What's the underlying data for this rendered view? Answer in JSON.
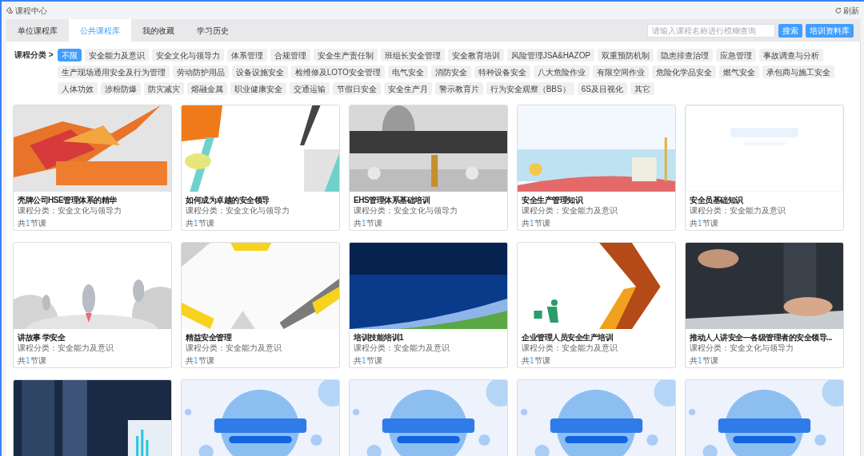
{
  "window": {
    "title": "课程中心",
    "refresh": "刷新"
  },
  "tabs": [
    {
      "label": "单位课程库",
      "selected": false
    },
    {
      "label": "公共课程库",
      "selected": true
    },
    {
      "label": "我的收藏",
      "selected": false
    },
    {
      "label": "学习历史",
      "selected": false
    }
  ],
  "search": {
    "placeholder": "请输入课程名称进行模糊查询",
    "button": "搜索"
  },
  "library_button": "培训资料库",
  "category_label": "课程分类 >",
  "category_rows": [
    [
      {
        "label": "不限",
        "selected": true
      },
      {
        "label": "安全能力及意识",
        "selected": false
      },
      {
        "label": "安全文化与领导力",
        "selected": false
      },
      {
        "label": "体系管理",
        "selected": false
      },
      {
        "label": "合规管理",
        "selected": false
      },
      {
        "label": "安全生产责任制",
        "selected": false
      },
      {
        "label": "班组长安全管理",
        "selected": false
      },
      {
        "label": "安全教育培训",
        "selected": false
      },
      {
        "label": "风险管理JSA&HAZOP",
        "selected": false
      },
      {
        "label": "双重预防机制",
        "selected": false
      },
      {
        "label": "隐患排查治理",
        "selected": false
      },
      {
        "label": "应急管理",
        "selected": false
      },
      {
        "label": "事故调查与分析",
        "selected": false
      }
    ],
    [
      {
        "label": "生产现场通用安全及行为管理",
        "selected": false
      },
      {
        "label": "劳动防护用品",
        "selected": false
      },
      {
        "label": "设备设施安全",
        "selected": false
      },
      {
        "label": "检维修及LOTO安全管理",
        "selected": false
      },
      {
        "label": "电气安全",
        "selected": false
      },
      {
        "label": "消防安全",
        "selected": false
      },
      {
        "label": "特种设备安全",
        "selected": false
      },
      {
        "label": "八大危险作业",
        "selected": false
      },
      {
        "label": "有限空间作业",
        "selected": false
      },
      {
        "label": "危险化学品安全",
        "selected": false
      },
      {
        "label": "燃气安全",
        "selected": false
      },
      {
        "label": "承包商与施工安全",
        "selected": false
      }
    ],
    [
      {
        "label": "人体功效",
        "selected": false
      },
      {
        "label": "涉粉防爆",
        "selected": false
      },
      {
        "label": "防灾减灾",
        "selected": false
      },
      {
        "label": "熔融金属",
        "selected": false
      },
      {
        "label": "职业健康安全",
        "selected": false
      },
      {
        "label": "交通运输",
        "selected": false
      },
      {
        "label": "节假日安全",
        "selected": false
      },
      {
        "label": "安全生产月",
        "selected": false
      },
      {
        "label": "警示教育片",
        "selected": false
      },
      {
        "label": "行为安全观察（BBS）",
        "selected": false
      },
      {
        "label": "6S及目视化",
        "selected": false
      },
      {
        "label": "其它",
        "selected": false
      }
    ]
  ],
  "courses": [
    {
      "cover": {
        "kind": "picture"
      },
      "title": "壳牌公司HSE管理体系的精华",
      "category": "课程分类：安全文化与领导力",
      "lessons": {
        "before": "共",
        "count": "1",
        "after": "节课"
      }
    },
    {
      "cover": {
        "kind": "picture"
      },
      "title": "如何成为卓越的安全领导",
      "category": "课程分类：安全文化与领导力",
      "lessons": {
        "before": "共",
        "count": "1",
        "after": "节课"
      }
    },
    {
      "cover": {
        "kind": "picture"
      },
      "title": "EHS管理体系基础培训",
      "category": "课程分类：安全文化与领导力",
      "lessons": {
        "before": "共",
        "count": "1",
        "after": "节课"
      }
    },
    {
      "cover": {
        "kind": "picture"
      },
      "title": "安全生产管理知识",
      "category": "课程分类：安全能力及意识",
      "lessons": {
        "before": "共",
        "count": "1",
        "after": "节课"
      }
    },
    {
      "cover": {
        "kind": "picture"
      },
      "title": "安全员基础知识",
      "category": "课程分类：安全能力及意识",
      "lessons": {
        "before": "共",
        "count": "1",
        "after": "节课"
      }
    },
    {
      "cover": {
        "kind": "picture"
      },
      "title": "讲故事 学安全",
      "category": "课程分类：安全能力及意识",
      "lessons": {
        "before": "共",
        "count": "1",
        "after": "节课"
      }
    },
    {
      "cover": {
        "kind": "picture"
      },
      "title": "精益安全管理",
      "category": "课程分类：安全能力及意识",
      "lessons": {
        "before": "共",
        "count": "1",
        "after": "节课"
      }
    },
    {
      "cover": {
        "kind": "picture"
      },
      "title": "培训技能培训1",
      "category": "课程分类：安全能力及意识",
      "lessons": {
        "before": "共",
        "count": "1",
        "after": "节课"
      }
    },
    {
      "cover": {
        "kind": "picture"
      },
      "title": "企业管理人员安全生产培训",
      "category": "课程分类：安全能力及意识",
      "lessons": {
        "before": "共",
        "count": "1",
        "after": "节课"
      }
    },
    {
      "cover": {
        "kind": "picture"
      },
      "title": "推动人人讲安全—各级管理者的安全领导...",
      "category": "课程分类：安全文化与领导力",
      "lessons": {
        "before": "共",
        "count": "1",
        "after": "节课"
      }
    },
    {
      "cover": {
        "kind": "picture"
      }
    },
    {
      "cover": {
        "kind": "picture"
      }
    },
    {
      "cover": {
        "kind": "picture"
      }
    },
    {
      "cover": {
        "kind": "picture"
      }
    },
    {
      "cover": {
        "kind": "picture"
      }
    }
  ]
}
